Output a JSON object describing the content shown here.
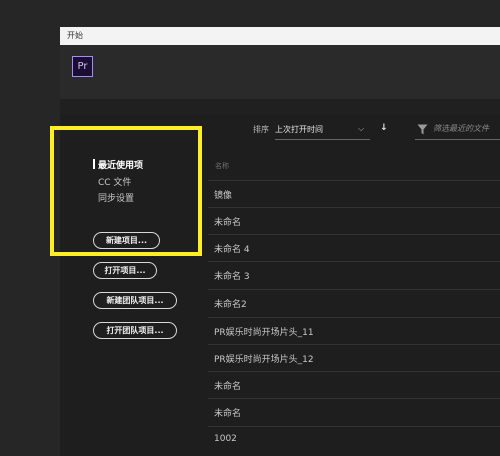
{
  "window": {
    "title": "开始"
  },
  "app": {
    "logo_text": "Pr"
  },
  "nav": {
    "items": [
      {
        "label": "最近使用项",
        "active": true
      },
      {
        "label": "CC 文件",
        "active": false
      },
      {
        "label": "同步设置",
        "active": false
      }
    ]
  },
  "actions": {
    "new_project": "新建项目...",
    "open_project": "打开项目...",
    "new_team_project": "新建团队项目...",
    "open_team_project": "打开团队项目..."
  },
  "toolbar": {
    "sort_label": "排序",
    "sort_value": "上次打开时间",
    "filter_placeholder": "筛选最近的文件"
  },
  "list": {
    "column_header": "名称",
    "rows": [
      "镜像",
      "未命名",
      "未命名 4",
      "未命名 3",
      "未命名2",
      "PR娱乐时尚开场片头_11",
      "PR娱乐时尚开场片头_12",
      "未命名",
      "未命名",
      "1002"
    ]
  },
  "colors": {
    "highlight": "#ffee25",
    "logo_border": "#a48bff",
    "logo_bg": "#1c0d33"
  }
}
